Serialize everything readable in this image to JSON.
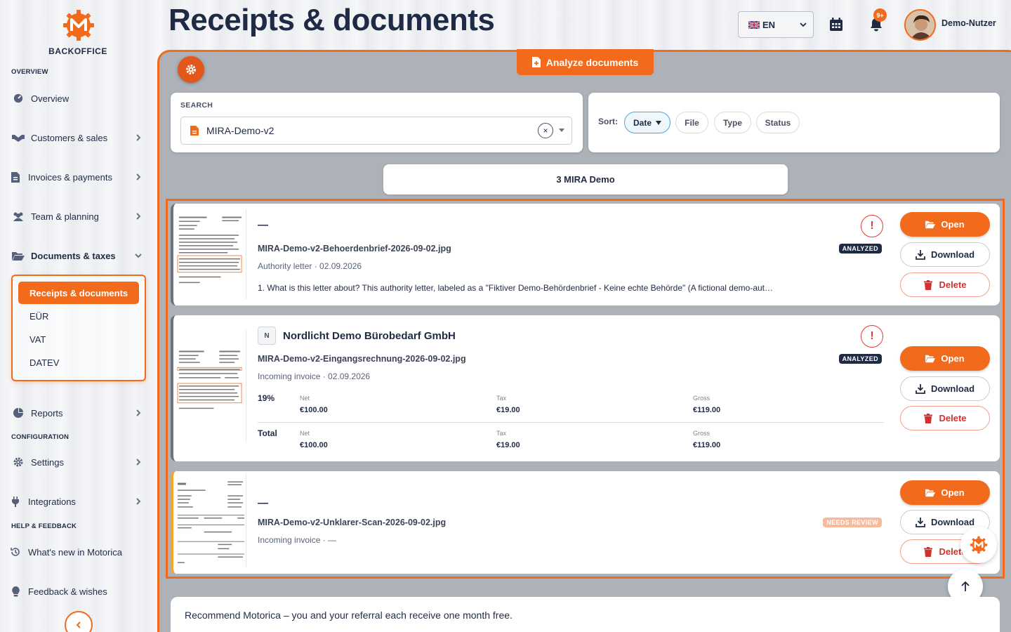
{
  "sidebar": {
    "brand": "BACKOFFICE",
    "sections": {
      "overview": "OVERVIEW",
      "configuration": "CONFIGURATION",
      "help": "HELP & FEEDBACK"
    },
    "items": {
      "overview": "Overview",
      "customers": "Customers & sales",
      "invoices": "Invoices & payments",
      "team": "Team & planning",
      "documents": "Documents & taxes",
      "reports": "Reports",
      "settings": "Settings",
      "integrations": "Integrations",
      "whats_new": "What's new in Motorica",
      "feedback": "Feedback & wishes"
    },
    "sub_items": {
      "receipts": "Receipts & documents",
      "eur": "EÜR",
      "vat": "VAT",
      "datev": "DATEV"
    }
  },
  "header": {
    "title": "Receipts & documents",
    "language": "EN",
    "notification_badge": "9+",
    "user": "Demo-Nutzer"
  },
  "toolbar": {
    "analyze_label": "Analyze documents"
  },
  "search": {
    "label": "SEARCH",
    "value": "MIRA-Demo-v2"
  },
  "sort": {
    "label": "Sort:",
    "options": [
      "Date",
      "File",
      "Type",
      "Status"
    ],
    "active": "Date"
  },
  "group": {
    "label": "3 MIRA Demo"
  },
  "documents": [
    {
      "title": "—",
      "file": "MIRA-Demo-v2-Behoerdenbrief-2026-09-02.jpg",
      "meta": "Authority letter · 02.09.2026",
      "description": "1. What is this letter about? This authority letter, labeled as a \"Fiktiver Demo-Behördenbrief - Keine echte Behörde\" (A fictional demo-aut…",
      "status": "ANALYZED"
    },
    {
      "vendor_initial": "N",
      "title": "Nordlicht Demo Bürobedarf GmbH",
      "file": "MIRA-Demo-v2-Eingangsrechnung-2026-09-02.jpg",
      "meta": "Incoming invoice · 02.09.2026",
      "status": "ANALYZED",
      "tax_rows": [
        {
          "rate": "19%",
          "net_label": "Net",
          "net": "€100.00",
          "tax_label": "Tax",
          "tax": "€19.00",
          "gross_label": "Gross",
          "gross": "€119.00"
        },
        {
          "rate": "Total",
          "net_label": "Net",
          "net": "€100.00",
          "tax_label": "Tax",
          "tax": "€19.00",
          "gross_label": "Gross",
          "gross": "€119.00"
        }
      ]
    },
    {
      "title": "—",
      "file": "MIRA-Demo-v2-Unklarer-Scan-2026-09-02.jpg",
      "meta": "Incoming invoice · —",
      "status": "NEEDS REVIEW"
    }
  ],
  "actions": {
    "open": "Open",
    "download": "Download",
    "delete": "Delete"
  },
  "referral": "Recommend Motorica – you and your referral each receive one month free.",
  "colors": {
    "accent": "#f26b1d",
    "navy": "#1f2a44",
    "danger": "#d32f2f"
  }
}
